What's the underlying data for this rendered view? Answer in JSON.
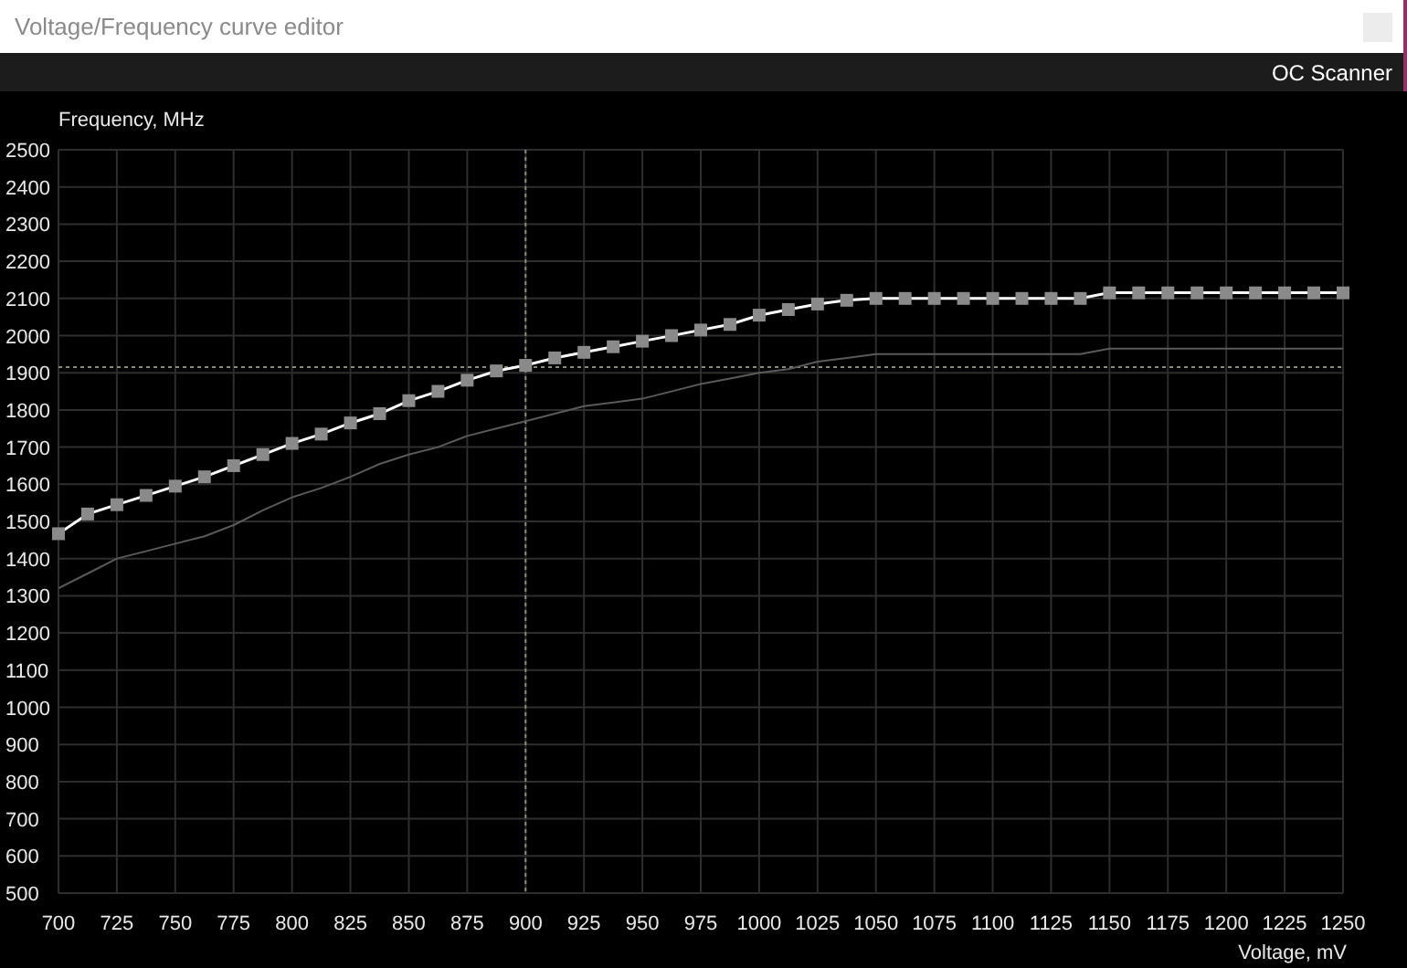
{
  "window": {
    "title": "Voltage/Frequency curve editor"
  },
  "toolbar": {
    "button": "OC Scanner"
  },
  "chart": {
    "chart_data": {
      "type": "line",
      "xlabel": "Voltage, mV",
      "ylabel": "Frequency, MHz",
      "x": [
        700,
        712.5,
        725,
        737.5,
        750,
        762.5,
        775,
        787.5,
        800,
        812.5,
        825,
        837.5,
        850,
        862.5,
        875,
        887.5,
        900,
        912.5,
        925,
        937.5,
        950,
        962.5,
        975,
        987.5,
        1000,
        1012.5,
        1025,
        1037.5,
        1050,
        1062.5,
        1075,
        1087.5,
        1100,
        1112.5,
        1125,
        1137.5,
        1150,
        1162.5,
        1175,
        1187.5,
        1200,
        1212.5,
        1225,
        1237.5,
        1250
      ],
      "series": [
        {
          "color": "#8a8a8a",
          "marker": "square",
          "values": [
            1467,
            1520,
            1545,
            1570,
            1595,
            1620,
            1650,
            1680,
            1710,
            1735,
            1765,
            1790,
            1825,
            1850,
            1880,
            1905,
            1920,
            1940,
            1955,
            1970,
            1985,
            2000,
            2015,
            2030,
            2055,
            2070,
            2085,
            2095,
            2100,
            2100,
            2100,
            2100,
            2100,
            2100,
            2100,
            2100,
            2115,
            2115,
            2115,
            2115,
            2115,
            2115,
            2115,
            2115,
            2115
          ]
        },
        {
          "color": "#5a5a5a",
          "values": [
            1320,
            1360,
            1400,
            1420,
            1440,
            1460,
            1490,
            1530,
            1565,
            1590,
            1620,
            1655,
            1680,
            1700,
            1730,
            1750,
            1770,
            1790,
            1810,
            1820,
            1830,
            1850,
            1870,
            1885,
            1900,
            1910,
            1930,
            1940,
            1950,
            1950,
            1950,
            1950,
            1950,
            1950,
            1950,
            1950,
            1965,
            1965,
            1965,
            1965,
            1965,
            1965,
            1965,
            1965,
            1965
          ]
        }
      ],
      "xlim": [
        700,
        1250
      ],
      "ylim": [
        500,
        2500
      ],
      "xticks": [
        700,
        725,
        750,
        775,
        800,
        825,
        850,
        875,
        900,
        925,
        950,
        975,
        1000,
        1025,
        1050,
        1075,
        1100,
        1125,
        1150,
        1175,
        1200,
        1225,
        1250
      ],
      "yticks": [
        500,
        600,
        700,
        800,
        900,
        1000,
        1100,
        1200,
        1300,
        1400,
        1500,
        1600,
        1700,
        1800,
        1900,
        2000,
        2100,
        2200,
        2300,
        2400,
        2500
      ],
      "grid": true,
      "ref_lines": [
        {
          "axis": "x",
          "value": 900,
          "color": "#8a8a70"
        },
        {
          "axis": "y",
          "value": 1915,
          "color": "#8a8a70"
        }
      ]
    }
  }
}
